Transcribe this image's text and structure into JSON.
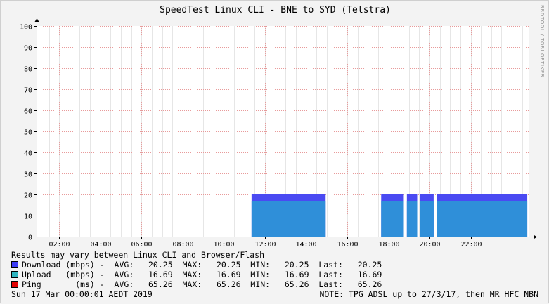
{
  "title": "SpeedTest Linux CLI - BNE to SYD (Telstra)",
  "watermark": "RRDTOOL / TOBI OETIKER",
  "notes": {
    "disclaimer": "Results may vary between Linux CLI and Browser/Flash",
    "timestamp": "Sun 17 Mar 00:00:01 AEDT 2019",
    "footnote": "NOTE: TPG ADSL up to 27/3/17, then MR HFC NBN"
  },
  "legend": [
    {
      "label": "Download (mbps) -  AVG:   20.25  MAX:   20.25  MIN:   20.25  Last:   20.25",
      "color": "#3d3df5"
    },
    {
      "label": "Upload   (mbps) -  AVG:   16.69  MAX:   16.69  MIN:   16.69  Last:   16.69",
      "color": "#2f9fd0"
    },
    {
      "label": "Ping       (ms) -  AVG:   65.26  MAX:   65.26  MIN:   65.26  Last:   65.26",
      "color": "#e00000"
    }
  ],
  "chart_data": {
    "type": "area",
    "title": "SpeedTest Linux CLI - BNE to SYD (Telstra)",
    "xlim": [
      0.9,
      24.85
    ],
    "ylim": [
      0,
      100
    ],
    "x_ticks": [
      "02:00",
      "04:00",
      "06:00",
      "08:00",
      "10:00",
      "12:00",
      "14:00",
      "16:00",
      "18:00",
      "20:00",
      "22:00"
    ],
    "x_tick_values": [
      2,
      4,
      6,
      8,
      10,
      12,
      14,
      16,
      18,
      20,
      22
    ],
    "y_ticks": [
      0,
      10,
      20,
      30,
      40,
      50,
      60,
      70,
      80,
      90,
      100
    ],
    "grid": true,
    "series": [
      {
        "name": "Download (mbps)",
        "value": 20.25,
        "color": "#4a4af2"
      },
      {
        "name": "Upload (mbps)",
        "value": 16.69,
        "color": "#2f8fd9"
      },
      {
        "name": "Ping (ms)",
        "value": 65.26,
        "display_value": 6.5,
        "color": "#c01010"
      }
    ],
    "segments": [
      [
        11.35,
        14.95
      ],
      [
        17.65,
        18.75
      ],
      [
        18.9,
        19.4
      ],
      [
        19.55,
        20.2
      ],
      [
        20.35,
        24.75
      ]
    ]
  }
}
